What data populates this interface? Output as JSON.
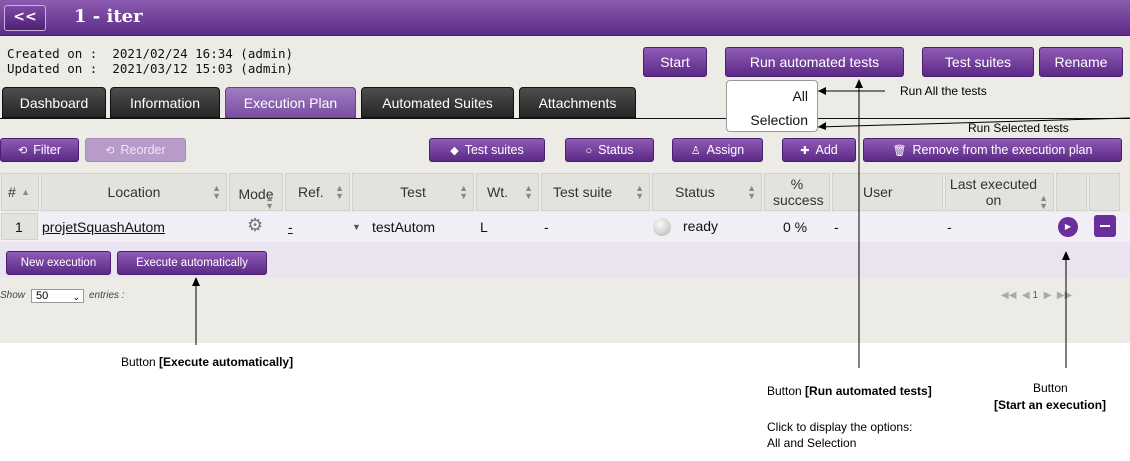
{
  "header": {
    "back_label": "<<",
    "title": "1 - iter"
  },
  "meta": {
    "created_label": "Created on :",
    "created_value": "2021/02/24 16:34 (admin)",
    "updated_label": "Updated on :",
    "updated_value": "2021/03/12 15:03 (admin)"
  },
  "actions": {
    "start": "Start",
    "run_automated": "Run automated tests",
    "test_suites": "Test suites",
    "rename": "Rename"
  },
  "run_menu": {
    "all": "All",
    "selection": "Selection"
  },
  "tabs": [
    {
      "label": "Dashboard",
      "active": false
    },
    {
      "label": "Information",
      "active": false
    },
    {
      "label": "Execution Plan",
      "active": true
    },
    {
      "label": "Automated Suites",
      "active": false
    },
    {
      "label": "Attachments",
      "active": false
    }
  ],
  "toolbar": {
    "filter": "Filter",
    "reorder": "Reorder",
    "test_suites": "Test suites",
    "status": "Status",
    "assign": "Assign",
    "add": "Add",
    "remove": "Remove from the execution plan"
  },
  "table": {
    "headers": {
      "num": "#",
      "location": "Location",
      "mode": "Mode",
      "ref": "Ref.",
      "test": "Test",
      "wt": "Wt.",
      "test_suite": "Test suite",
      "status": "Status",
      "success": "% success",
      "user": "User",
      "last_executed": "Last executed on"
    },
    "row": {
      "num": "1",
      "location": "projetSquashAutom",
      "ref": "-",
      "test": "testAutom",
      "wt": "L",
      "test_suite": "-",
      "status": "ready",
      "success": "0 %",
      "user": "-",
      "last_executed": "-"
    },
    "row_actions": {
      "new_execution": "New execution",
      "execute_auto": "Execute automatically"
    }
  },
  "footer": {
    "show_label": "Show",
    "entries_value": "50",
    "entries_label": "entries :",
    "page": "1"
  },
  "annotations": {
    "run_all": "Run All the tests",
    "run_selected": "Run Selected tests",
    "execute_auto_prefix": "Button ",
    "execute_auto_bold": "[Execute automatically]",
    "run_automated_prefix": "Button ",
    "run_automated_bold": "[Run automated tests]",
    "run_automated_desc1": "Click to display the options:",
    "run_automated_desc2": "All and Selection",
    "start_exec_line1": "Button",
    "start_exec_bold": "[Start an execution]"
  },
  "colors": {
    "accent": "#6b3a94",
    "tab_dark": "#333333",
    "panel": "#ecebe6"
  }
}
